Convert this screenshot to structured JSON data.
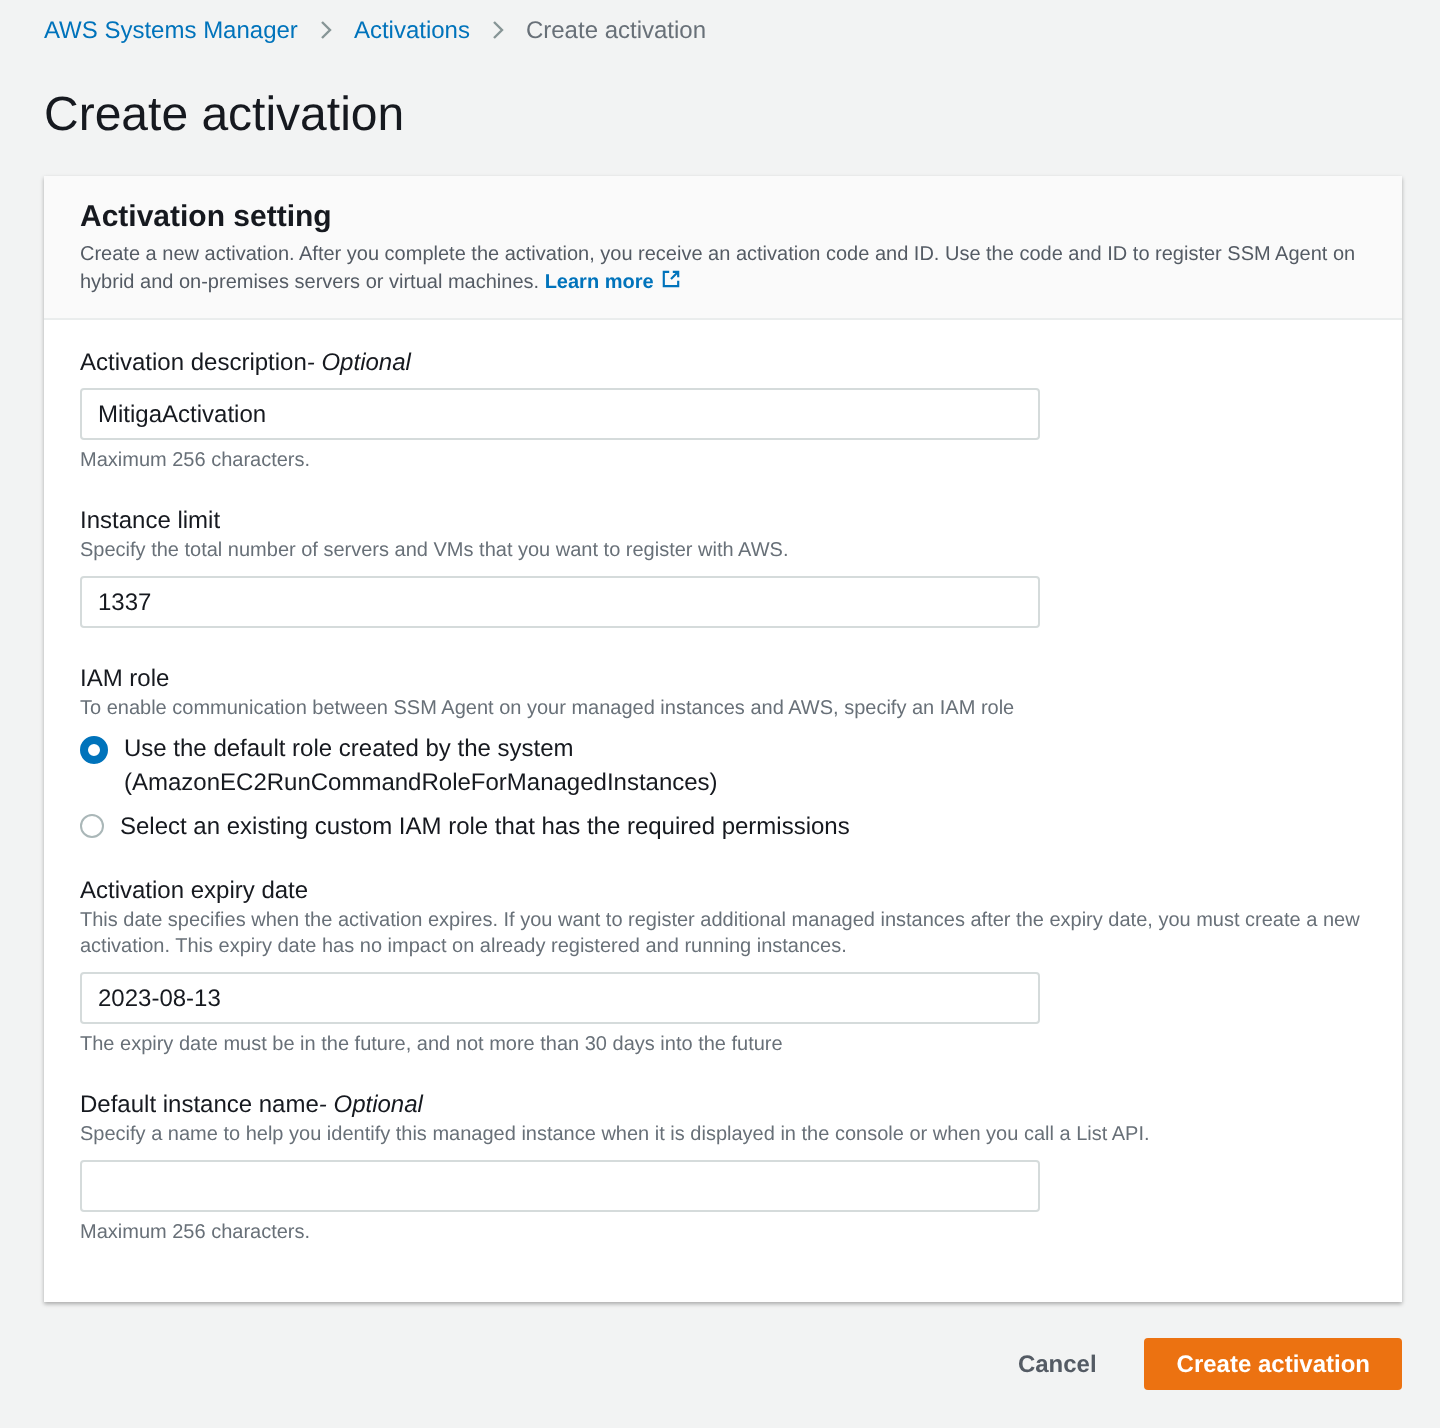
{
  "breadcrumb": [
    {
      "label": "AWS Systems Manager",
      "kind": "link"
    },
    {
      "label": "Activations",
      "kind": "link"
    },
    {
      "label": "Create activation",
      "kind": "current"
    }
  ],
  "title": "Create activation",
  "panel": {
    "title": "Activation setting",
    "description": "Create a new activation. After you complete the activation, you receive an activation code and ID. Use the code and ID to register SSM Agent on hybrid and on-premises servers or virtual machines.",
    "link": "Learn more"
  },
  "fields": [
    {
      "kind": "text",
      "label": "Activation description",
      "optional": "- Optional",
      "value": "MitigaActivation",
      "hint": "Maximum 256 characters."
    },
    {
      "kind": "text",
      "label": "Instance limit",
      "description": "Specify the total number of servers and VMs that you want to register with AWS.",
      "value": "1337"
    },
    {
      "kind": "radio",
      "label": "IAM role",
      "description": "To enable communication between SSM Agent on your managed instances and AWS, specify an IAM role",
      "options": [
        {
          "label": "Use the default role created by the system (AmazonEC2RunCommandRoleForManagedInstances)",
          "selected": true
        },
        {
          "label": "Select an existing custom IAM role that has the required permissions",
          "selected": false
        }
      ]
    },
    {
      "kind": "text",
      "label": "Activation expiry date",
      "description": "This date specifies when the activation expires. If you want to register additional managed instances after the expiry date, you must create a new activation. This expiry date has no impact on already registered and running instances.",
      "value": "2023-08-13",
      "hint": "The expiry date must be in the future, and not more than 30 days into the future"
    },
    {
      "kind": "text",
      "label": "Default instance name",
      "optional": "- Optional",
      "description": "Specify a name to help you identify this managed instance when it is displayed in the console or when you call a List API.",
      "hint": "Maximum 256 characters."
    }
  ],
  "actions": [
    {
      "label": "Cancel",
      "kind": "secondary"
    },
    {
      "label": "Create activation",
      "kind": "primary"
    }
  ]
}
